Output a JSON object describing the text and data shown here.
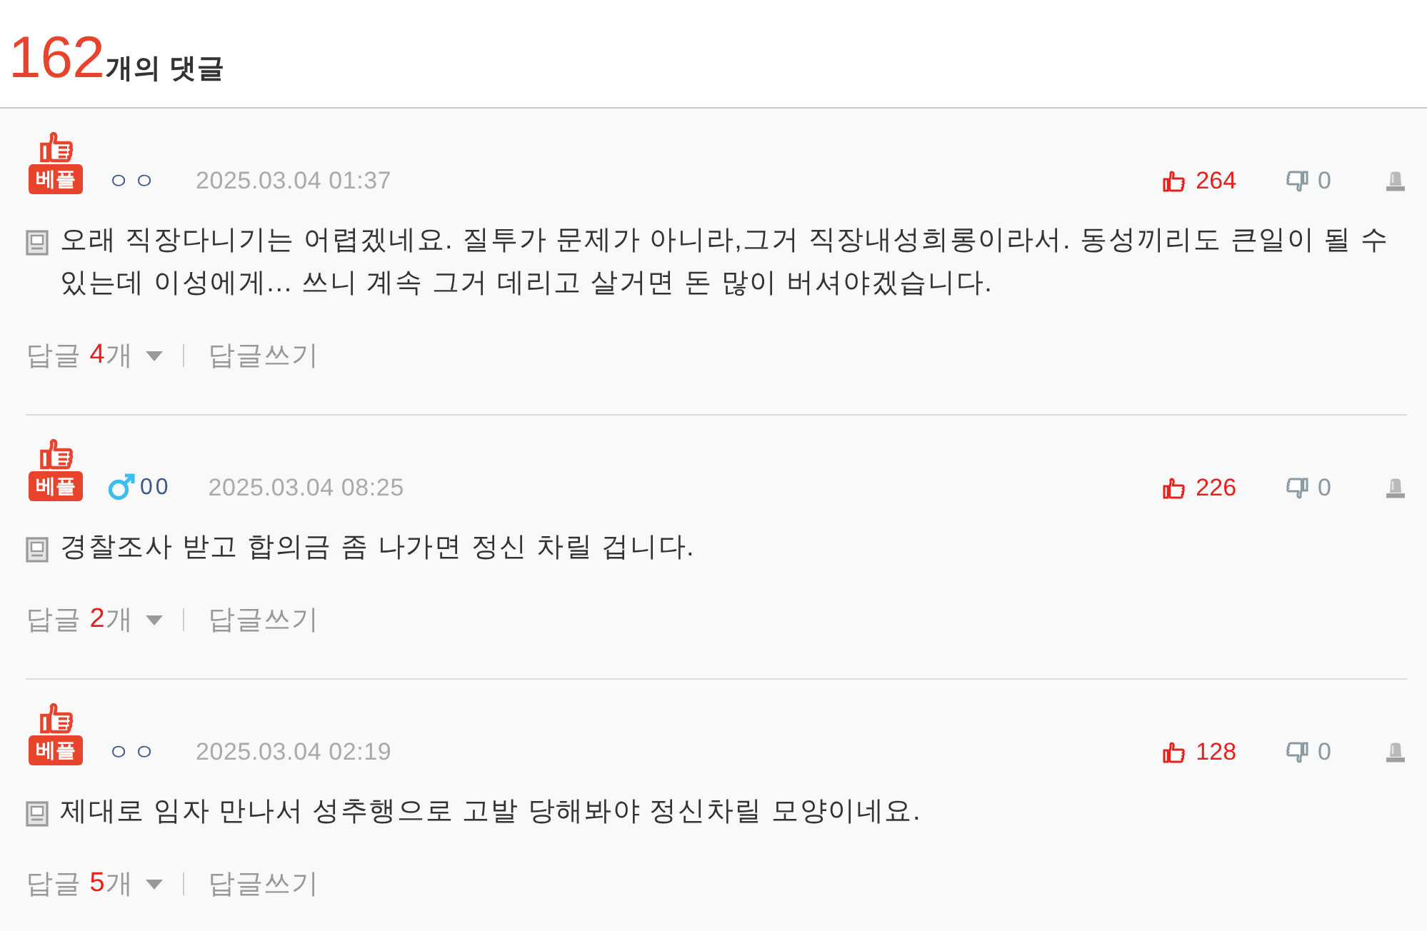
{
  "header": {
    "count": "162",
    "label": "개의 댓글"
  },
  "comments": [
    {
      "badge": "베플",
      "male": false,
      "author": "ㅇㅇ",
      "date": "2025.03.04 01:37",
      "likes": "264",
      "dislikes": "0",
      "text": "오래 직장다니기는 어렵겠네요. 질투가 문제가 아니라,그거 직장내성희롱이라서. 동성끼리도 큰일이 될 수 있는데 이성에게... 쓰니 계속 그거 데리고 살거면 돈 많이 버셔야겠습니다.",
      "reply_label": "답글",
      "reply_count": "4",
      "reply_unit": "개",
      "write_reply": "답글쓰기"
    },
    {
      "badge": "베플",
      "male": true,
      "author": "00",
      "date": "2025.03.04 08:25",
      "likes": "226",
      "dislikes": "0",
      "text": "경찰조사 받고 합의금 좀 나가면 정신 차릴 겁니다.",
      "reply_label": "답글",
      "reply_count": "2",
      "reply_unit": "개",
      "write_reply": "답글쓰기"
    },
    {
      "badge": "베플",
      "male": false,
      "author": "ㅇㅇ",
      "date": "2025.03.04 02:19",
      "likes": "128",
      "dislikes": "0",
      "text": "제대로 임자 만나서 성추행으로 고발 당해봐야 정신차릴 모양이네요.",
      "reply_label": "답글",
      "reply_count": "5",
      "reply_unit": "개",
      "write_reply": "답글쓰기"
    }
  ]
}
